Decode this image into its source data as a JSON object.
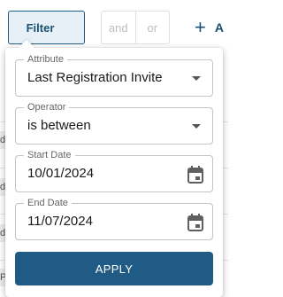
{
  "toolbar": {
    "filter_label": "Filter",
    "logic_and": "and",
    "logic_or": "or",
    "add_label": "A"
  },
  "background_rows": [
    "d",
    "d",
    "d",
    "Pa"
  ],
  "filter_popover": {
    "attribute": {
      "label": "Attribute",
      "value": "Last Registration Invite"
    },
    "operator": {
      "label": "Operator",
      "value": "is between"
    },
    "start_date": {
      "label": "Start Date",
      "value": "10/01/2024",
      "icon": "calendar-icon"
    },
    "end_date": {
      "label": "End Date",
      "value": "11/07/2024",
      "icon": "calendar-icon"
    },
    "apply_label": "APPLY"
  },
  "colors": {
    "primary": "#1f5b84",
    "filter_bg": "#e6f0f6",
    "border": "#c4c4c4"
  }
}
